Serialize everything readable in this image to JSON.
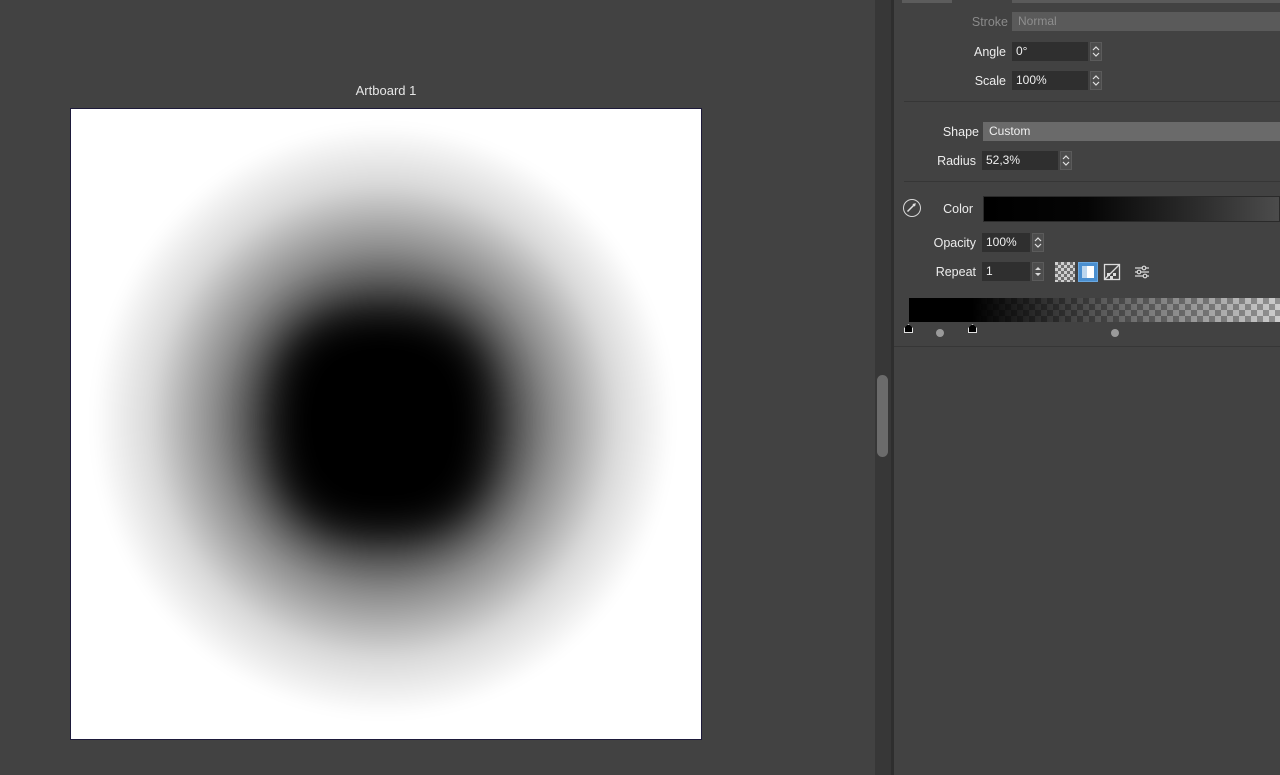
{
  "canvas": {
    "artboard_title": "Artboard 1"
  },
  "panel": {
    "stroke": {
      "label": "Stroke",
      "value": "Normal"
    },
    "angle": {
      "label": "Angle",
      "value": "0°"
    },
    "scale": {
      "label": "Scale",
      "value": "100%"
    },
    "shape": {
      "label": "Shape",
      "value": "Custom"
    },
    "radius": {
      "label": "Radius",
      "value": "52,3%"
    },
    "color": {
      "label": "Color"
    },
    "opacity": {
      "label": "Opacity",
      "value": "100%"
    },
    "repeat": {
      "label": "Repeat",
      "value": "1"
    }
  },
  "colors": {
    "panel_bg": "#424242",
    "field_bg": "#2f2f2f",
    "dropdown_bg": "#6a6a6a",
    "active_mode": "#4a8fd0"
  },
  "icons": [
    "color-picker-icon",
    "transparency-mode-icon",
    "repeat-mode-icon",
    "reflect-mode-icon",
    "settings-sliders-icon"
  ]
}
